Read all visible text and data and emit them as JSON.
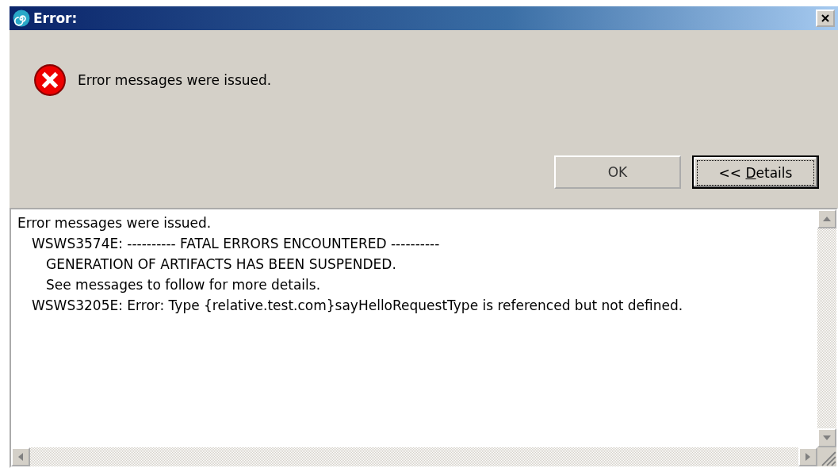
{
  "window": {
    "title": "Error:"
  },
  "message": "Error messages were issued.",
  "buttons": [
    {
      "label": "OK",
      "focused": false
    },
    {
      "label": "<< Details",
      "focused": true
    }
  ],
  "details": [
    {
      "text": "Error messages were issued.",
      "children": [
        {
          "text": "WSWS3574E: ---------- FATAL ERRORS ENCOUNTERED ----------",
          "children": [
            {
              "text": "GENERATION OF ARTIFACTS HAS BEEN SUSPENDED."
            },
            {
              "text": "See messages to follow for more details."
            }
          ]
        },
        {
          "text": "WSWS3205E: Error: Type {relative.test.com}sayHelloRequestType is referenced but not defined."
        }
      ]
    }
  ]
}
